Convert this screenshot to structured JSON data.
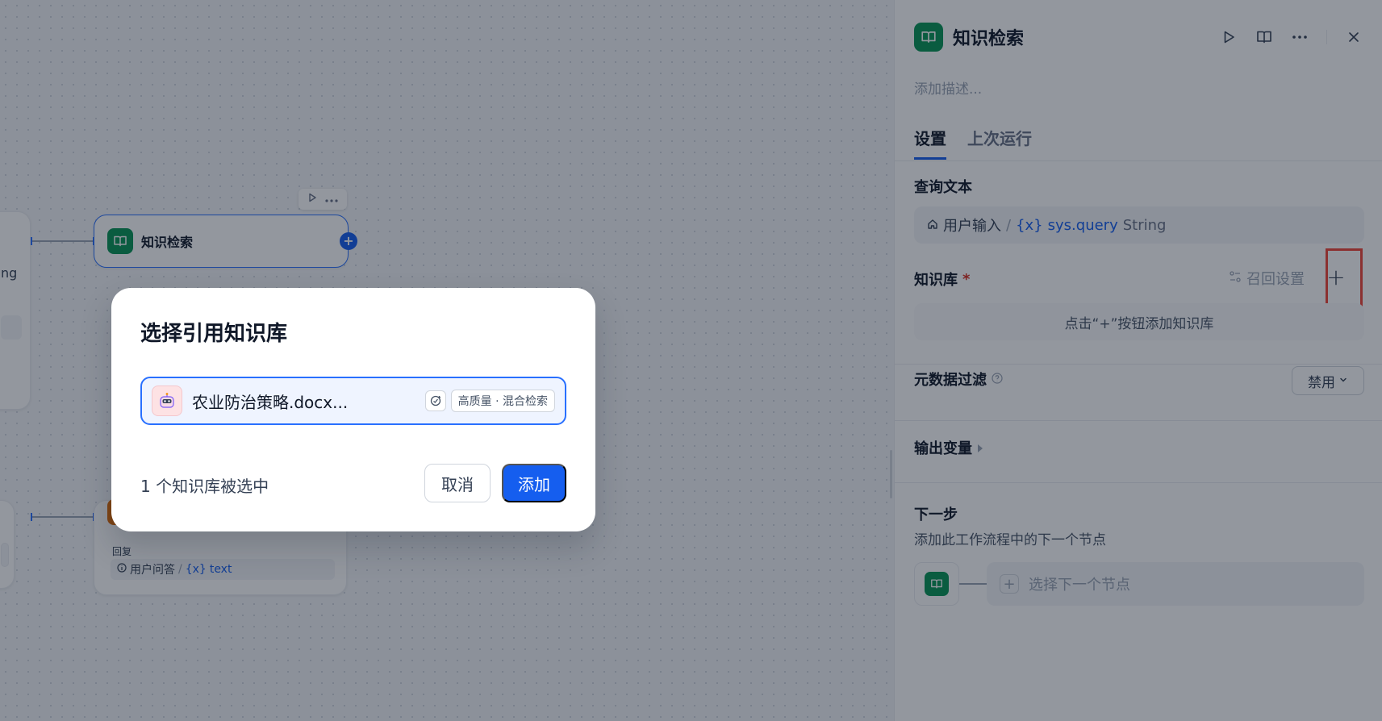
{
  "canvas": {
    "node_title": "知识检索",
    "left_node_text": "ng",
    "answer_label": "回复",
    "answer_var_prefix": "用户问答",
    "answer_var_sep": "/",
    "answer_var_symbol": "{x}",
    "answer_var_name": "text"
  },
  "panel": {
    "title": "知识检索",
    "description_placeholder": "添加描述...",
    "tabs": [
      {
        "label": "设置",
        "active": true
      },
      {
        "label": "上次运行",
        "active": false
      }
    ],
    "query": {
      "label": "查询文本",
      "source": "用户输入",
      "sep": "/",
      "var_symbol": "{x}",
      "var_name": "sys.query",
      "type": "String"
    },
    "knowledge": {
      "label": "知识库",
      "required": "*",
      "recall_settings": "召回设置",
      "add_symbol": "+",
      "empty_hint": "点击“+”按钮添加知识库"
    },
    "metadata": {
      "label": "元数据过滤",
      "value": "禁用"
    },
    "output_label": "输出变量",
    "next": {
      "label": "下一步",
      "subtitle": "添加此工作流程中的下一个节点",
      "select_placeholder": "选择下一个节点"
    }
  },
  "modal": {
    "title": "选择引用知识库",
    "item": {
      "name": "农业防治策略.docx...",
      "badge": "高质量 · 混合检索"
    },
    "selected_count": "1 个知识库被选中",
    "cancel": "取消",
    "add": "添加"
  },
  "colors": {
    "primary": "#155eef",
    "node_green": "#079455",
    "highlight_red": "#f04438"
  }
}
